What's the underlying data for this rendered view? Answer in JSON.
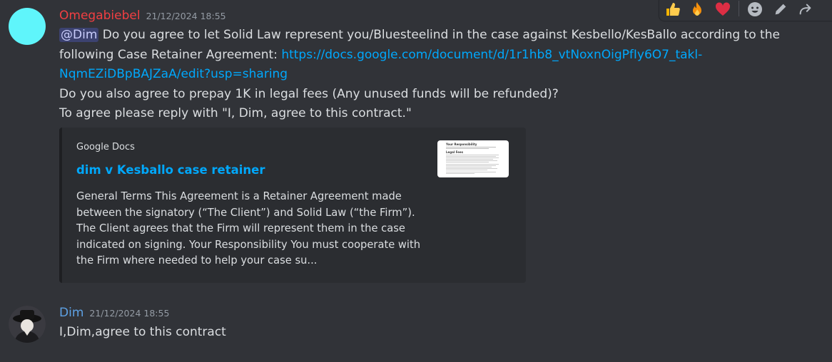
{
  "messages": [
    {
      "author": "Omegabiebel",
      "author_color": "#f23f42",
      "timestamp": "21/12/2024 18:55",
      "mention": "@Dim",
      "line1_text": " Do you agree to let Solid Law represent you/Bluesteelind in the case against Kesbello/KesBallo according to the",
      "line2_text": "following Case Retainer Agreement: ",
      "link_part1": "https://docs.google.com/document/d/1r1hb8_vtNoxnOigPfIy6O7_takl-",
      "link_part2": "NqmEZiDBpBAJZaA/edit?usp=sharing",
      "line4_text": "Do you also agree to prepay 1K in legal fees (Any unused funds will be refunded)?",
      "line5_text": "To agree please reply with \"I, Dim, agree to this contract.\"",
      "embed": {
        "provider": "Google Docs",
        "title": "dim v Kesballo case retainer",
        "description_lines": [
          "General Terms This Agreement is a Retainer Agreement made",
          "between the signatory (“The Client”) and Solid Law (“the Firm”).",
          "The Client agrees that the Firm will represent them in the case",
          "indicated on signing. Your Responsibility You must cooperate with",
          "the Firm where needed to help your case su..."
        ],
        "thumbnail": {
          "heading": "Your Responsibility",
          "subheading": "Legal Fees"
        }
      }
    },
    {
      "author": "Dim",
      "author_color": "#5ea2e5",
      "timestamp": "21/12/2024 18:55",
      "text": "I,Dim,agree to this contract"
    }
  ],
  "toolbar": {
    "reactions": [
      "thumbs-up-icon",
      "fire-icon",
      "heart-icon"
    ],
    "actions": [
      "add-reaction-icon",
      "edit-icon",
      "reply-icon"
    ]
  },
  "colors": {
    "background": "#313338",
    "link": "#00a8fc",
    "embed_bg": "#2b2d31",
    "avatar_omegabiebel": "#5ff5fb"
  }
}
